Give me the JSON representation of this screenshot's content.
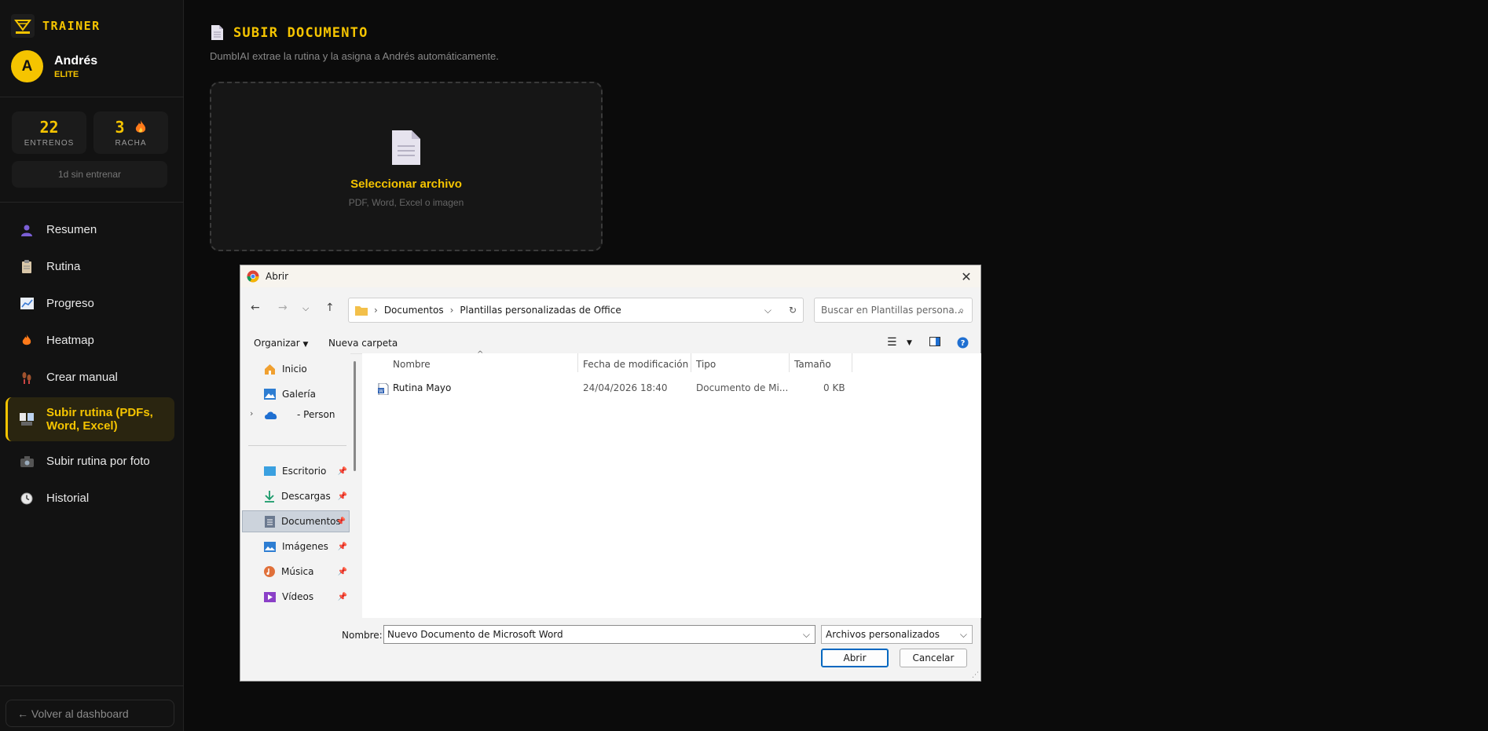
{
  "brand": {
    "name": "TRAINER",
    "logo_text": "TRAINER"
  },
  "user": {
    "initial": "A",
    "name": "Andrés",
    "tier": "ELITE"
  },
  "stats": [
    {
      "value": "22",
      "label": "ENTRENOS"
    },
    {
      "value": "3",
      "label": "RACHA",
      "icon": "fire-icon"
    }
  ],
  "idle_text": "1d sin entrenar",
  "nav": [
    {
      "label": "Resumen",
      "icon": "user-icon"
    },
    {
      "label": "Rutina",
      "icon": "clipboard-icon"
    },
    {
      "label": "Progreso",
      "icon": "chart-icon"
    },
    {
      "label": "Heatmap",
      "icon": "fire-icon"
    },
    {
      "label": "Crear manual",
      "icon": "footprints-icon"
    },
    {
      "label": "Subir rutina (PDFs, Word, Excel)",
      "icon": "upload-doc-icon",
      "active": true
    },
    {
      "label": "Subir rutina por foto",
      "icon": "camera-icon"
    },
    {
      "label": "Historial",
      "icon": "clock-icon"
    }
  ],
  "back_label": "← Volver al dashboard",
  "main": {
    "title": "SUBIR DOCUMENTO",
    "subtitle": "DumbIAI extrae la rutina y la asigna a Andrés automáticamente.",
    "drop_title": "Seleccionar archivo",
    "drop_sub": "PDF, Word, Excel o imagen"
  },
  "dialog": {
    "title": "Abrir",
    "path": [
      "Documentos",
      "Plantillas personalizadas de Office"
    ],
    "search_placeholder": "Buscar en Plantillas persona...",
    "organize": "Organizar",
    "new_folder": "Nueva carpeta",
    "tree": [
      {
        "label": "Inicio",
        "icon": "home-icon"
      },
      {
        "label": "Galería",
        "icon": "gallery-icon"
      },
      {
        "label": "- Person",
        "icon": "onedrive-icon"
      },
      {
        "label": "Escritorio",
        "icon": "desktop-icon",
        "pinned": true
      },
      {
        "label": "Descargas",
        "icon": "download-icon",
        "pinned": true
      },
      {
        "label": "Documentos",
        "icon": "documents-icon",
        "pinned": true,
        "selected": true
      },
      {
        "label": "Imágenes",
        "icon": "pictures-icon",
        "pinned": true
      },
      {
        "label": "Música",
        "icon": "music-icon",
        "pinned": true
      },
      {
        "label": "Vídeos",
        "icon": "videos-icon",
        "pinned": true
      }
    ],
    "columns": [
      "Nombre",
      "Fecha de modificación",
      "Tipo",
      "Tamaño"
    ],
    "files": [
      {
        "name": "Rutina Mayo",
        "date": "24/04/2026 18:40",
        "type": "Documento de Mi...",
        "size": "0 KB"
      }
    ],
    "name_label": "Nombre:",
    "name_value": "Nuevo Documento de Microsoft Word",
    "type_value": "Archivos personalizados",
    "open_label": "Abrir",
    "cancel_label": "Cancelar"
  },
  "colors": {
    "accent": "#f5c400",
    "background": "#0b0b0b",
    "sidebar": "#121212"
  }
}
